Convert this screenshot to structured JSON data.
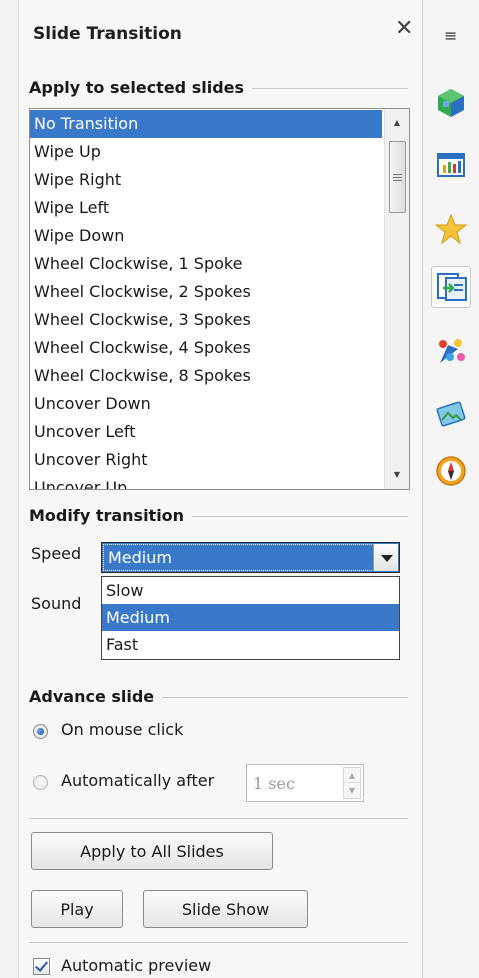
{
  "panel": {
    "title": "Slide Transition",
    "close_glyph": "✕"
  },
  "apply_section": {
    "heading": "Apply to selected slides",
    "transitions": [
      "No Transition",
      "Wipe Up",
      "Wipe Right",
      "Wipe Left",
      "Wipe Down",
      "Wheel Clockwise, 1 Spoke",
      "Wheel Clockwise, 2 Spokes",
      "Wheel Clockwise, 3 Spokes",
      "Wheel Clockwise, 4 Spokes",
      "Wheel Clockwise, 8 Spokes",
      "Uncover Down",
      "Uncover Left",
      "Uncover Right",
      "Uncover Up"
    ],
    "selected": "No Transition"
  },
  "modify_section": {
    "heading": "Modify transition",
    "speed_label": "Speed",
    "speed_value": "Medium",
    "speed_options": [
      "Slow",
      "Medium",
      "Fast"
    ],
    "sound_label": "Sound"
  },
  "advance_section": {
    "heading": "Advance slide",
    "on_click_label": "On mouse click",
    "auto_label": "Automatically after",
    "auto_value": "1 sec",
    "selected": "on_click"
  },
  "buttons": {
    "apply_all": "Apply to All Slides",
    "play": "Play",
    "slide_show": "Slide Show"
  },
  "preview": {
    "label": "Automatic preview",
    "checked": true
  },
  "sidebar": {
    "menu_glyph": "≡",
    "icons": [
      "properties-icon",
      "master-slides-icon",
      "custom-animation-icon",
      "slide-transition-icon",
      "styles-icon",
      "gallery-icon",
      "navigator-icon"
    ],
    "active": "slide-transition-icon"
  },
  "colors": {
    "selection": "#3a78c9",
    "panel_bg": "#f7f7f7"
  }
}
